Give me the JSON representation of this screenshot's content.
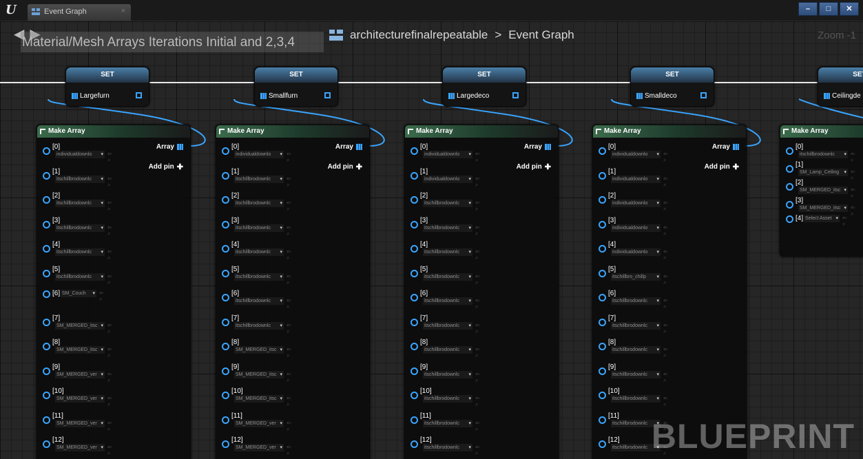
{
  "window": {
    "app_logo": "U",
    "tab_title": "Event Graph",
    "tab_close": "×",
    "buttons": [
      "–",
      "□",
      "✕"
    ]
  },
  "graph": {
    "nav_back": "◀",
    "nav_forward": "▶",
    "comment_title": "Material/Mesh Arrays Iterations Initial and 2,3,4",
    "breadcrumb": {
      "project": "architecturefinalrepeatable",
      "separator": ">",
      "graph": "Event Graph"
    },
    "zoom_label": "Zoom -1",
    "watermark": "BLUEPRINT"
  },
  "set_nodes": [
    {
      "title": "SET",
      "variable": "Largefurn"
    },
    {
      "title": "SET",
      "variable": "Smallfurn"
    },
    {
      "title": "SET",
      "variable": "Largedeco"
    },
    {
      "title": "SET",
      "variable": "Smalldeco"
    },
    {
      "title": "SET",
      "variable": "Ceilingde"
    }
  ],
  "make_array_nodes": [
    {
      "title": "Make Array",
      "output_label": "Array",
      "add_pin_label": "Add pin",
      "pins": [
        {
          "index": "[0]",
          "value": "individualdownlo"
        },
        {
          "index": "[1]",
          "value": "itschillbrodownlc"
        },
        {
          "index": "[2]",
          "value": "itschillbrodownlc"
        },
        {
          "index": "[3]",
          "value": "itschillbrodownlc"
        },
        {
          "index": "[4]",
          "value": "itschillbrodownlc"
        },
        {
          "index": "[5]",
          "value": "itschillbrodownlc"
        },
        {
          "index": "[6]",
          "value": "SM_Couch"
        },
        {
          "index": "[7]",
          "value": "SM_MERGED_itsc"
        },
        {
          "index": "[8]",
          "value": "SM_MERGED_itsc"
        },
        {
          "index": "[9]",
          "value": "SM_MERGED_ver"
        },
        {
          "index": "[10]",
          "value": "SM_MERGED_ver"
        },
        {
          "index": "[11]",
          "value": "SM_MERGED_ver"
        },
        {
          "index": "[12]",
          "value": "SM_MERGED_ver"
        }
      ]
    },
    {
      "title": "Make Array",
      "output_label": "Array",
      "add_pin_label": "Add pin",
      "pins": [
        {
          "index": "[0]",
          "value": "individualdownlo"
        },
        {
          "index": "[1]",
          "value": "itschillbrodownlc"
        },
        {
          "index": "[2]",
          "value": "itschillbrodownlc"
        },
        {
          "index": "[3]",
          "value": "itschillbrodownlc"
        },
        {
          "index": "[4]",
          "value": "itschillbrodownlc"
        },
        {
          "index": "[5]",
          "value": "itschillbrodownlc"
        },
        {
          "index": "[6]",
          "value": "itschillbrodownlc"
        },
        {
          "index": "[7]",
          "value": "itschillbrodownlc"
        },
        {
          "index": "[8]",
          "value": "SM_MERGED_itsc"
        },
        {
          "index": "[9]",
          "value": "SM_MERGED_itsc"
        },
        {
          "index": "[10]",
          "value": "SM_MERGED_itsc"
        },
        {
          "index": "[11]",
          "value": "SM_MERGED_ver"
        },
        {
          "index": "[12]",
          "value": "SM_MERGED_ver"
        }
      ]
    },
    {
      "title": "Make Array",
      "output_label": "Array",
      "add_pin_label": "Add pin",
      "pins": [
        {
          "index": "[0]",
          "value": "individualdownlo"
        },
        {
          "index": "[1]",
          "value": "individualdownlo"
        },
        {
          "index": "[2]",
          "value": "itschillbrodownlc"
        },
        {
          "index": "[3]",
          "value": "itschillbrodownlc"
        },
        {
          "index": "[4]",
          "value": "itschillbrodownlc"
        },
        {
          "index": "[5]",
          "value": "itschillbrodownlc"
        },
        {
          "index": "[6]",
          "value": "itschillbrodownlc"
        },
        {
          "index": "[7]",
          "value": "itschillbrodownlc"
        },
        {
          "index": "[8]",
          "value": "itschillbrodownlc"
        },
        {
          "index": "[9]",
          "value": "itschillbrodownlc"
        },
        {
          "index": "[10]",
          "value": "itschillbrodownlc"
        },
        {
          "index": "[11]",
          "value": "itschillbrodownlc"
        },
        {
          "index": "[12]",
          "value": "itschillbrodownlc"
        }
      ]
    },
    {
      "title": "Make Array",
      "output_label": "Array",
      "add_pin_label": "Add pin",
      "pins": [
        {
          "index": "[0]",
          "value": "individualdownlo"
        },
        {
          "index": "[1]",
          "value": "individualdownlo"
        },
        {
          "index": "[2]",
          "value": "individualdownlo"
        },
        {
          "index": "[3]",
          "value": "individualdownlo"
        },
        {
          "index": "[4]",
          "value": "individualdownlo"
        },
        {
          "index": "[5]",
          "value": "itschillbro_chillp"
        },
        {
          "index": "[6]",
          "value": "itschillbrodownlc"
        },
        {
          "index": "[7]",
          "value": "itschillbrodownlc"
        },
        {
          "index": "[8]",
          "value": "itschillbrodownlc"
        },
        {
          "index": "[9]",
          "value": "itschillbrodownlc"
        },
        {
          "index": "[10]",
          "value": "itschillbrodownlc"
        },
        {
          "index": "[11]",
          "value": "itschillbrodownlc"
        },
        {
          "index": "[12]",
          "value": "itschillbrodownlc"
        }
      ]
    },
    {
      "title": "Make Array",
      "output_label": "",
      "add_pin_label": "",
      "pins": [
        {
          "index": "[0]",
          "value": "itschillbrodownlc"
        },
        {
          "index": "[1]",
          "value": "SM_Lamp_Ceiling"
        },
        {
          "index": "[2]",
          "value": "SM_MERGED_itsc"
        },
        {
          "index": "[3]",
          "value": "SM_MERGED_itsc"
        },
        {
          "index": "[4]",
          "value": "Select Asset"
        }
      ]
    }
  ],
  "colors": {
    "accent_blue": "#3aa5ff",
    "set_header": "#4a7fa8",
    "make_array_header": "#3b6b4b"
  }
}
